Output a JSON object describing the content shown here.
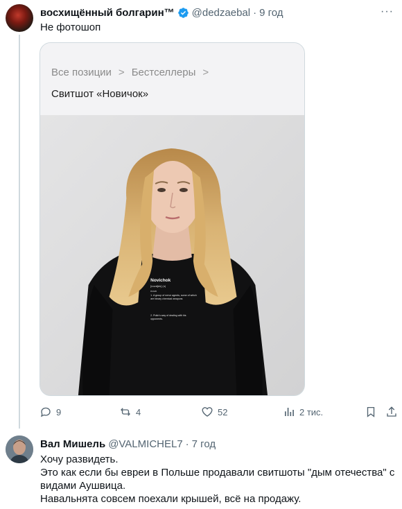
{
  "tweet1": {
    "display_name": "восхищённый болгарин™",
    "handle": "@dedzaebal",
    "separator": "·",
    "time": "9 год",
    "text": "Не фотошоп",
    "card": {
      "breadcrumb": [
        "Все позиции",
        "Бестселлеры"
      ],
      "breadcrumb_sep": ">",
      "product_title": "Свитшот «Новичок»",
      "shirt_print": {
        "word": "Novichok",
        "pron": "[novɪtʃɒk] (n)",
        "pos": "noun",
        "def1": "1. A group of nerve agents, some of which are binary chemical weapons",
        "def2": "2. Putin's way of dealing with his opponents."
      }
    },
    "actions": {
      "reply_count": "9",
      "retweet_count": "4",
      "like_count": "52",
      "views_count": "2 тис."
    },
    "accent_color": "#1d9bf0"
  },
  "tweet2": {
    "display_name": "Вал Мишель",
    "handle": "@VALMICHEL7",
    "separator": "·",
    "time": "7 год",
    "lines": [
      "Хочу развидеть.",
      "Это как если бы евреи в Польше продавали свитшоты \"дым отечества\" с видами Аушвица.",
      "Навальнята совсем поехали крышей, всё на продажу."
    ]
  }
}
